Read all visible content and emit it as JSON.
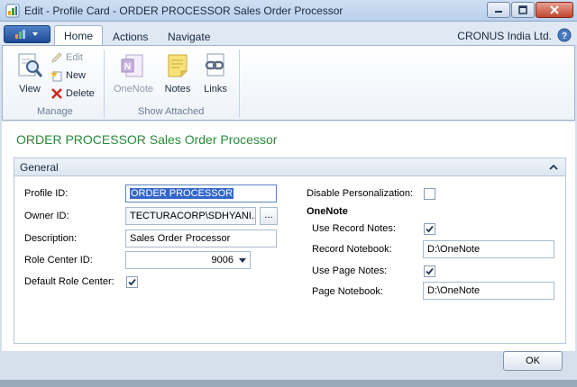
{
  "window": {
    "title": "Edit - Profile Card - ORDER PROCESSOR Sales Order Processor"
  },
  "ribbon": {
    "tabs": [
      {
        "label": "Home",
        "active": true
      },
      {
        "label": "Actions",
        "active": false
      },
      {
        "label": "Navigate",
        "active": false
      }
    ],
    "company": "CRONUS India Ltd.",
    "groups": {
      "manage": {
        "label": "Manage",
        "view": "View",
        "edit": "Edit",
        "new": "New",
        "delete": "Delete"
      },
      "show_attached": {
        "label": "Show Attached",
        "onenote": "OneNote",
        "notes": "Notes",
        "links": "Links"
      }
    }
  },
  "page": {
    "title": "ORDER PROCESSOR Sales Order Processor",
    "fasttab": "General",
    "fields": {
      "profile_id": {
        "label": "Profile ID:",
        "value": "ORDER PROCESSOR"
      },
      "owner_id": {
        "label": "Owner ID:",
        "value": "TECTURACORP\\SDHYANI...",
        "assist": "..."
      },
      "description": {
        "label": "Description:",
        "value": "Sales Order Processor"
      },
      "role_center_id": {
        "label": "Role Center ID:",
        "value": "9006"
      },
      "default_role_center": {
        "label": "Default Role Center:",
        "checked": true
      },
      "disable_personalization": {
        "label": "Disable Personalization:",
        "checked": false
      },
      "onenote_heading": "OneNote",
      "use_record_notes": {
        "label": "Use Record Notes:",
        "checked": true
      },
      "record_notebook": {
        "label": "Record Notebook:",
        "value": "D:\\OneNote"
      },
      "use_page_notes": {
        "label": "Use Page Notes:",
        "checked": true
      },
      "page_notebook": {
        "label": "Page Notebook:",
        "value": "D:\\OneNote"
      }
    }
  },
  "footer": {
    "ok": "OK"
  },
  "colors": {
    "page_title": "#2a8a3a",
    "selection": "#3366cc",
    "ribbon_border": "#9fb4cf"
  },
  "icons": [
    "dynamics-app-icon",
    "minimize-icon",
    "maximize-icon",
    "close-icon",
    "help-icon",
    "view-icon",
    "edit-icon",
    "new-icon",
    "delete-icon",
    "onenote-icon",
    "notes-icon",
    "links-icon",
    "collapse-icon",
    "checkmark-icon",
    "dropdown-arrow-icon"
  ]
}
